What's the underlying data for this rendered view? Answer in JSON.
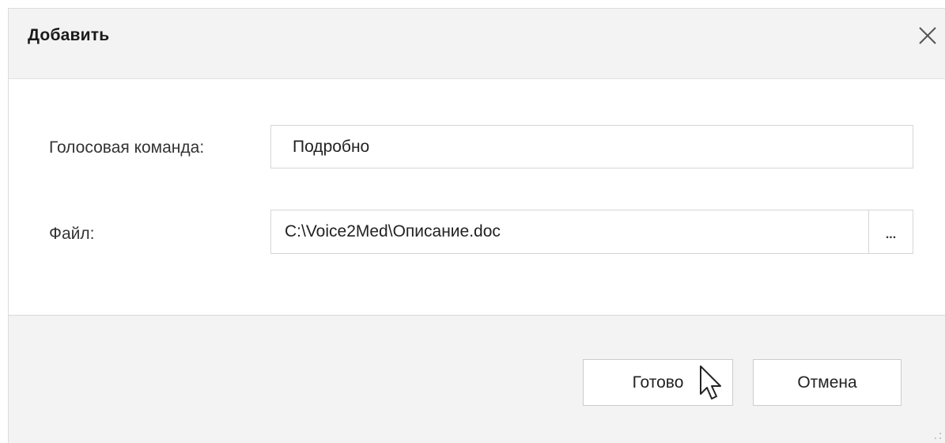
{
  "dialog": {
    "title": "Добавить",
    "close_icon": "close-icon"
  },
  "form": {
    "voice_command": {
      "label": "Голосовая команда:",
      "value": "Подробно"
    },
    "file": {
      "label": "Файл:",
      "value": "C:\\Voice2Med\\Описание.doc",
      "browse_label": "..."
    }
  },
  "footer": {
    "done_label": "Готово",
    "cancel_label": "Отмена"
  },
  "colors": {
    "header_bg": "#f3f3f3",
    "footer_bg": "#f3f3f3",
    "body_bg": "#ffffff",
    "border": "#d6d6d6"
  }
}
